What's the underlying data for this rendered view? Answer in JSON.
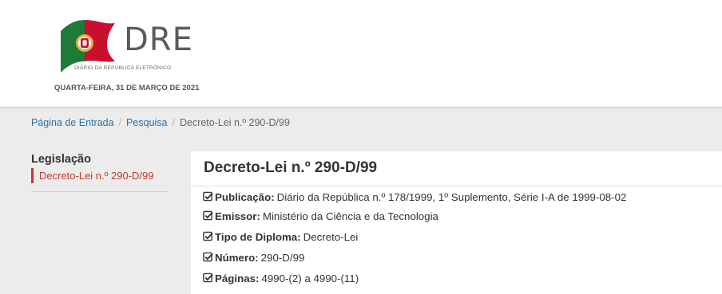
{
  "header": {
    "logo_text": "DRE",
    "logo_subtitle": "DIÁRIO DA REPÚBLICA ELETRÓNICO",
    "date": "QUARTA-FEIRA, 31 DE MARÇO DE 2021",
    "colors": {
      "green": "#1f7a3a",
      "red": "#c8102e",
      "gold": "#e2b13c"
    }
  },
  "breadcrumb": {
    "items": [
      "Página de Entrada",
      "Pesquisa"
    ],
    "current": "Decreto-Lei n.º 290-D/99",
    "separator": "/"
  },
  "sidebar": {
    "title": "Legislação",
    "items": [
      {
        "label": "Decreto-Lei n.º 290-D/99"
      }
    ],
    "accent": "#c0392b"
  },
  "document": {
    "title": "Decreto-Lei n.º 290-D/99",
    "fields": [
      {
        "label": "Publicação:",
        "value": "Diário da República n.º 178/1999, 1º Suplemento, Série I-A de 1999-08-02",
        "icon": "check-square-icon"
      },
      {
        "label": "Emissor:",
        "value": "Ministério da Ciência e da Tecnologia",
        "icon": "check-square-icon"
      },
      {
        "label": "Tipo de Diploma:",
        "value": "Decreto-Lei",
        "icon": "check-square-icon"
      },
      {
        "label": "Número:",
        "value": "290-D/99",
        "icon": "check-square-icon"
      },
      {
        "label": "Páginas:",
        "value": "4990-(2) a 4990-(11)",
        "icon": "check-square-icon"
      }
    ]
  }
}
